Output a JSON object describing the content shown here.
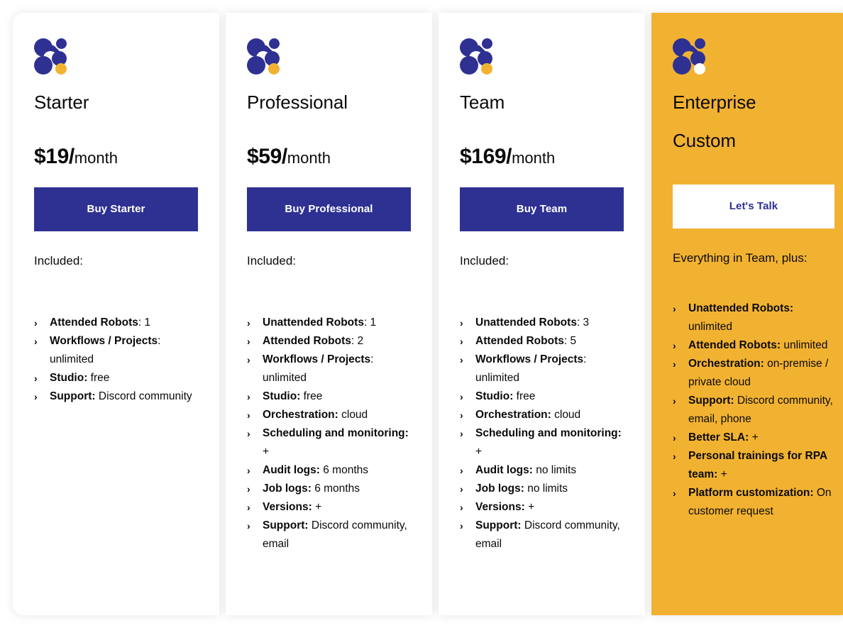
{
  "theme": {
    "brand_blue": "#2E3192",
    "accent_yellow": "#F2B231",
    "text": "#0A0A0A",
    "card_bg": "#FFFFFF"
  },
  "plans": [
    {
      "id": "starter",
      "name": "Starter",
      "price_amount": "$19/",
      "price_period": "month",
      "cta_label": "Buy Starter",
      "included_label": "Included:",
      "features": [
        {
          "label": "Attended Robots",
          "sep": ": ",
          "value": "1"
        },
        {
          "label": "Workflows / Projects",
          "sep": ": ",
          "value": "unlimited"
        },
        {
          "label": "Studio:",
          "sep": " ",
          "value": "free"
        },
        {
          "label": "Support:",
          "sep": " ",
          "value": "Discord community"
        }
      ]
    },
    {
      "id": "professional",
      "name": "Professional",
      "price_amount": "$59/",
      "price_period": "month",
      "cta_label": "Buy Professional",
      "included_label": "Included:",
      "features": [
        {
          "label": "Unattended Robots",
          "sep": ": ",
          "value": "1"
        },
        {
          "label": "Attended Robots",
          "sep": ": ",
          "value": "2"
        },
        {
          "label": "Workflows / Projects",
          "sep": ": ",
          "value": "unlimited"
        },
        {
          "label": "Studio:",
          "sep": " ",
          "value": "free"
        },
        {
          "label": "Orchestration:",
          "sep": " ",
          "value": "cloud"
        },
        {
          "label": "Scheduling and monitoring:",
          "sep": " ",
          "value": "+"
        },
        {
          "label": "Audit logs:",
          "sep": " ",
          "value": "6 months"
        },
        {
          "label": "Job logs:",
          "sep": " ",
          "value": "6 months"
        },
        {
          "label": "Versions:",
          "sep": " ",
          "value": "+"
        },
        {
          "label": "Support:",
          "sep": " ",
          "value": "Discord community, email"
        }
      ]
    },
    {
      "id": "team",
      "name": "Team",
      "price_amount": "$169/",
      "price_period": "month",
      "cta_label": "Buy Team",
      "included_label": "Included:",
      "features": [
        {
          "label": "Unattended Robots",
          "sep": ": ",
          "value": "3"
        },
        {
          "label": "Attended Robots",
          "sep": ": ",
          "value": "5"
        },
        {
          "label": "Workflows / Projects",
          "sep": ": ",
          "value": "unlimited"
        },
        {
          "label": "Studio:",
          "sep": " ",
          "value": "free"
        },
        {
          "label": "Orchestration:",
          "sep": " ",
          "value": "cloud"
        },
        {
          "label": "Scheduling and monitoring:",
          "sep": " ",
          "value": "+"
        },
        {
          "label": "Audit logs:",
          "sep": " ",
          "value": "no limits"
        },
        {
          "label": "Job logs:",
          "sep": " ",
          "value": "no limits"
        },
        {
          "label": "Versions:",
          "sep": " ",
          "value": "+"
        },
        {
          "label": "Support:",
          "sep": " ",
          "value": "Discord community, email"
        }
      ]
    },
    {
      "id": "enterprise",
      "name": "Enterprise",
      "price_amount": "Custom",
      "price_period": "",
      "cta_label": "Let's Talk",
      "included_label": "Everything in Team, plus:",
      "features": [
        {
          "label": "Unattended Robots:",
          "sep": " ",
          "value": "unlimited"
        },
        {
          "label": "Attended Robots:",
          "sep": " ",
          "value": "unlimited"
        },
        {
          "label": "Orchestration:",
          "sep": " ",
          "value": "on-premise / private cloud"
        },
        {
          "label": "Support:",
          "sep": " ",
          "value": "Discord community, email, phone"
        },
        {
          "label": "Better SLA:",
          "sep": " ",
          "value": "+"
        },
        {
          "label": "Personal trainings for RPA team:",
          "sep": " ",
          "value": "+"
        },
        {
          "label": "Platform customization:",
          "sep": " ",
          "value": "On customer request"
        }
      ]
    }
  ],
  "icons": {
    "bullet_chevron": "›",
    "logo": "brand-dots-logo"
  }
}
